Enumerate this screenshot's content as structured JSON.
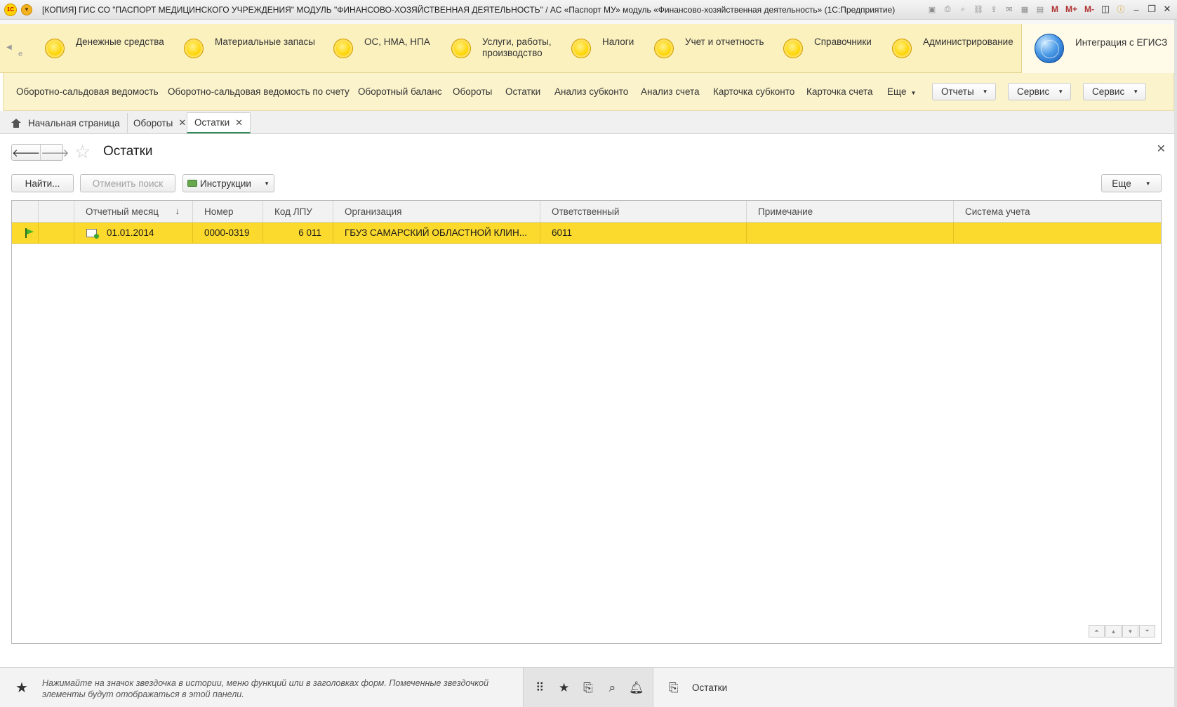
{
  "window": {
    "logo": "1С",
    "title": "[КОПИЯ] ГИС СО \"ПАСПОРТ МЕДИЦИНСКОГО УЧРЕЖДЕНИЯ\" МОДУЛЬ \"ФИНАНСОВО-ХОЗЯЙСТВЕННАЯ ДЕЯТЕЛЬНОСТЬ\" / АС «Паспорт МУ» модуль «Финансово-хозяйственная деятельность» (1С:Предприятие)",
    "toolbar_m": "M",
    "toolbar_mplus": "M+",
    "toolbar_mminus": "M-"
  },
  "sections": {
    "hint_letter": "е",
    "items": [
      {
        "label": "Денежные средства"
      },
      {
        "label": "Материальные запасы"
      },
      {
        "label": "ОС, НМА, НПА"
      },
      {
        "label": "Услуги, работы, производство"
      },
      {
        "label": "Налоги"
      },
      {
        "label": "Учет и отчетность"
      },
      {
        "label": "Справочники"
      },
      {
        "label": "Администрирование"
      }
    ],
    "egisz": "Интеграция с ЕГИСЗ"
  },
  "functions": {
    "items": [
      {
        "label": "Оборотно-сальдовая ведомость"
      },
      {
        "label": "Оборотно-сальдовая ведомость по счету"
      },
      {
        "label": "Оборотный баланс"
      },
      {
        "label": "Обороты"
      },
      {
        "label": "Остатки"
      },
      {
        "label": "Анализ субконто"
      },
      {
        "label": "Анализ счета"
      },
      {
        "label": "Карточка субконто"
      },
      {
        "label": "Карточка счета"
      }
    ],
    "more": "Еще",
    "reports": "Отчеты",
    "service1": "Сервис",
    "service2": "Сервис"
  },
  "tabs": {
    "home": "Начальная страница",
    "turnovers": "Обороты",
    "balances": "Остатки"
  },
  "form": {
    "title": "Остатки",
    "find": "Найти...",
    "cancel_search": "Отменить поиск",
    "instructions": "Инструкции",
    "more": "Еще"
  },
  "table": {
    "columns": {
      "month": "Отчетный месяц",
      "number": "Номер",
      "lpu_code": "Код ЛПУ",
      "organization": "Организация",
      "responsible": "Ответственный",
      "note": "Примечание",
      "accounting": "Система учета"
    },
    "rows": [
      {
        "month": "01.01.2014",
        "number": "0000-0319",
        "lpu_code": "6 011",
        "organization": "ГБУЗ САМАРСКИЙ ОБЛАСТНОЙ КЛИН...",
        "responsible": "6011",
        "note": "",
        "accounting": ""
      }
    ]
  },
  "footer": {
    "favorites_hint": "Нажимайте на значок звездочка в истории, меню функций или в заголовках форм. Помеченные звездочкой элементы будут отображаться в этой панели.",
    "history_item": "Остатки"
  },
  "colors": {
    "sections_bg": "#fbf1bf",
    "selected_row": "#fbd92d",
    "active_tab_underline": "#2e8b57"
  }
}
